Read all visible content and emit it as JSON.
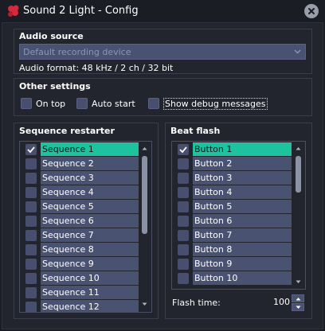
{
  "window": {
    "title": "Sound 2 Light - Config"
  },
  "audio_source": {
    "title": "Audio source",
    "device_placeholder": "Default recording device",
    "format_text": "Audio format: 48 kHz / 2 ch / 32 bit"
  },
  "other_settings": {
    "title": "Other settings",
    "options": [
      {
        "label": "On top",
        "checked": false
      },
      {
        "label": "Auto start",
        "checked": false
      },
      {
        "label": "Show debug messages",
        "checked": false
      }
    ]
  },
  "sequence_restarter": {
    "title": "Sequence restarter",
    "items": [
      {
        "label": "Sequence 1",
        "checked": true,
        "selected": true
      },
      {
        "label": "Sequence 2",
        "checked": false,
        "selected": false
      },
      {
        "label": "Sequence 3",
        "checked": false,
        "selected": false
      },
      {
        "label": "Sequence 4",
        "checked": false,
        "selected": false
      },
      {
        "label": "Sequence 5",
        "checked": false,
        "selected": false
      },
      {
        "label": "Sequence 6",
        "checked": false,
        "selected": false
      },
      {
        "label": "Sequence 7",
        "checked": false,
        "selected": false
      },
      {
        "label": "Sequence 8",
        "checked": false,
        "selected": false
      },
      {
        "label": "Sequence 9",
        "checked": false,
        "selected": false
      },
      {
        "label": "Sequence 10",
        "checked": false,
        "selected": false
      },
      {
        "label": "Sequence 11",
        "checked": false,
        "selected": false
      },
      {
        "label": "Sequence 12",
        "checked": false,
        "selected": false
      }
    ]
  },
  "beat_flash": {
    "title": "Beat flash",
    "items": [
      {
        "label": "Button 1",
        "checked": true,
        "selected": true
      },
      {
        "label": "Button 2",
        "checked": false,
        "selected": false
      },
      {
        "label": "Button 3",
        "checked": false,
        "selected": false
      },
      {
        "label": "Button 4",
        "checked": false,
        "selected": false
      },
      {
        "label": "Button 5",
        "checked": false,
        "selected": false
      },
      {
        "label": "Button 6",
        "checked": false,
        "selected": false
      },
      {
        "label": "Button 7",
        "checked": false,
        "selected": false
      },
      {
        "label": "Button 8",
        "checked": false,
        "selected": false
      },
      {
        "label": "Button 9",
        "checked": false,
        "selected": false
      },
      {
        "label": "Button 10",
        "checked": false,
        "selected": false
      }
    ],
    "flash_time_label": "Flash time:",
    "flash_time_value": "100"
  },
  "colors": {
    "accent": "#1ec29e",
    "window_bg": "#23252e",
    "field_bg": "#4a5272",
    "icon_red": "#d8283c"
  }
}
